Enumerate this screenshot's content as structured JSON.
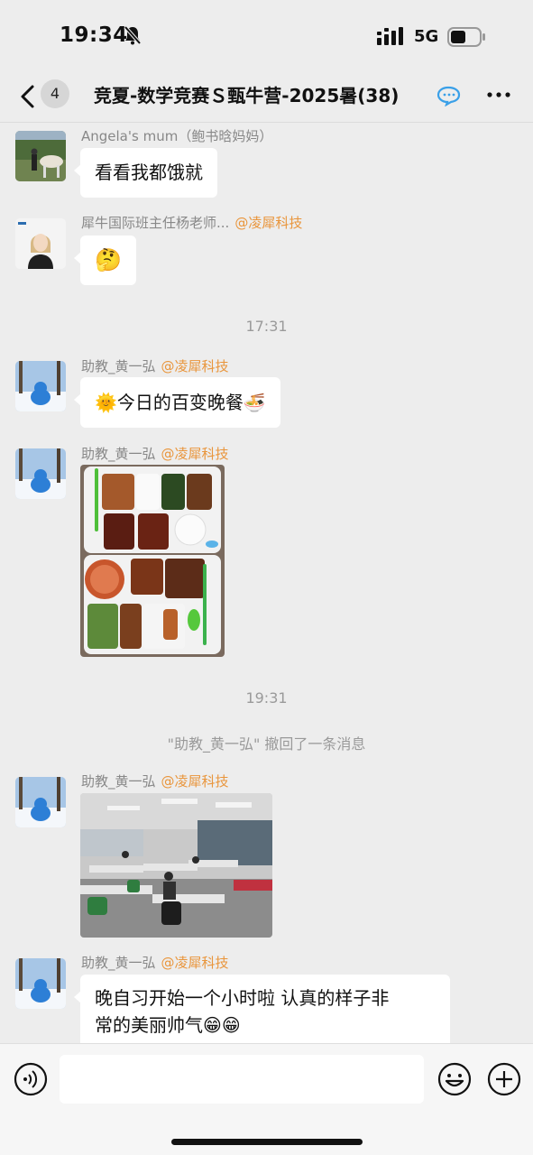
{
  "status_bar": {
    "time": "19:34",
    "network": "5G",
    "icons": [
      "bell-muted-icon",
      "signal-icon",
      "battery-icon"
    ]
  },
  "nav": {
    "unread_count": "4",
    "title": "竞夏-数学竞赛Ｓ甄牛营-2025暑(38)",
    "icons": [
      "back-icon",
      "group-chat-icon",
      "more-icon"
    ]
  },
  "messages": [
    {
      "sender": "Angela's mum（鲍书晗妈妈）",
      "text": "看看我都饿就"
    },
    {
      "sender": "犀牛国际班主任杨老师...",
      "mention": "@凌犀科技",
      "text": "🤔"
    },
    {
      "timestamp": "17:31"
    },
    {
      "sender": "助教_黄一弘",
      "mention": "@凌犀科技",
      "text": "🌞今日的百变晚餐🍜"
    },
    {
      "sender": "助教_黄一弘",
      "mention": "@凌犀科技",
      "image": "dinner-tray-photo"
    },
    {
      "timestamp": "19:31"
    },
    {
      "system": "\"助教_黄一弘\" 撤回了一条消息"
    },
    {
      "sender": "助教_黄一弘",
      "mention": "@凌犀科技",
      "image": "classroom-photo"
    },
    {
      "sender": "助教_黄一弘",
      "mention": "@凌犀科技",
      "text_line1": "晚自习开始一个小时啦 认真的样子非",
      "text_line2": "常的美丽帅气😁😁"
    }
  ],
  "input_bar": {
    "placeholder": "",
    "icons": [
      "voice-icon",
      "emoji-icon",
      "plus-icon"
    ]
  },
  "colors": {
    "background": "#ededed",
    "bubble": "#ffffff",
    "mention": "#e9953b",
    "meta_text": "#888888"
  }
}
